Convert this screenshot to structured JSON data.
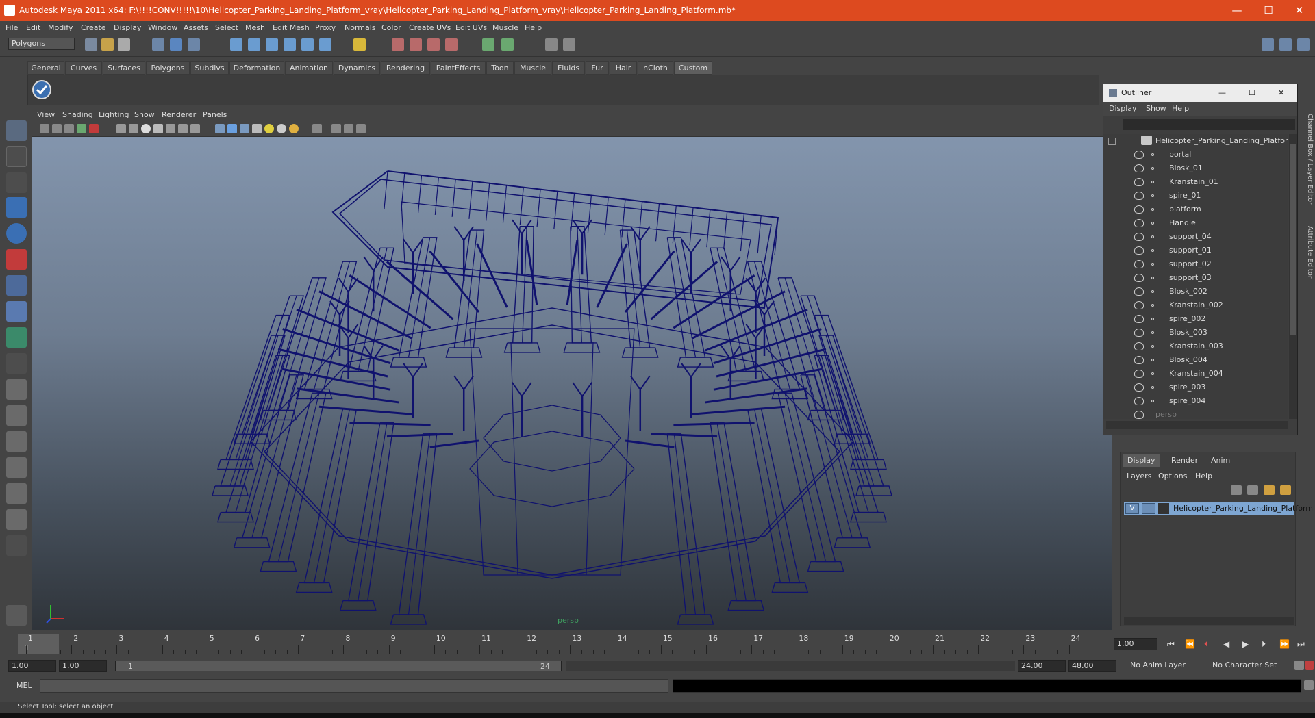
{
  "window": {
    "title": "Autodesk Maya 2011 x64: F:\\!!!!CONV!!!!!\\10\\Helicopter_Parking_Landing_Platform_vray\\Helicopter_Parking_Landing_Platform_vray\\Helicopter_Parking_Landing_Platform.mb*",
    "minimize": "—",
    "maximize": "☐",
    "close": "✕",
    "title_color": "#dd4a1f"
  },
  "menubar": [
    "File",
    "Edit",
    "Modify",
    "Create",
    "Display",
    "Window",
    "Assets",
    "Select",
    "Mesh",
    "Edit Mesh",
    "Proxy",
    "Normals",
    "Color",
    "Create UVs",
    "Edit UVs",
    "Muscle",
    "Help"
  ],
  "status": {
    "mode": "Polygons"
  },
  "shelf_tabs": [
    {
      "label": "General"
    },
    {
      "label": "Curves"
    },
    {
      "label": "Surfaces"
    },
    {
      "label": "Polygons"
    },
    {
      "label": "Subdivs"
    },
    {
      "label": "Deformation"
    },
    {
      "label": "Animation"
    },
    {
      "label": "Dynamics"
    },
    {
      "label": "Rendering"
    },
    {
      "label": "PaintEffects"
    },
    {
      "label": "Toon"
    },
    {
      "label": "Muscle"
    },
    {
      "label": "Fluids"
    },
    {
      "label": "Fur"
    },
    {
      "label": "Hair"
    },
    {
      "label": "nCloth"
    },
    {
      "label": "Custom",
      "active": true
    }
  ],
  "viewport": {
    "menu": [
      "View",
      "Shading",
      "Lighting",
      "Show",
      "Renderer",
      "Panels"
    ],
    "camera": "persp",
    "wire_color": "#10126e"
  },
  "outliner": {
    "title": "Outliner",
    "menu": [
      "Display",
      "Show",
      "Help"
    ],
    "root": "Helicopter_Parking_Landing_Platform",
    "items": [
      "portal",
      "Blosk_01",
      "Kranstain_01",
      "spire_01",
      "platform",
      "Handle",
      "support_04",
      "support_01",
      "support_02",
      "support_03",
      "Blosk_002",
      "Kranstain_002",
      "spire_002",
      "Blosk_003",
      "Kranstain_003",
      "Blosk_004",
      "Kranstain_004",
      "spire_003",
      "spire_004"
    ],
    "trailing": "persp"
  },
  "side_tabs": [
    "Channel Box / Layer Editor",
    "Attribute Editor"
  ],
  "layers": {
    "tabs": [
      "Display",
      "Render",
      "Anim"
    ],
    "menu": [
      "Layers",
      "Options",
      "Help"
    ],
    "layer_name": "Helicopter_Parking_Landing_Platform",
    "visible_flag": "V"
  },
  "timeline": {
    "frames": [
      "1",
      "2",
      "3",
      "4",
      "5",
      "6",
      "7",
      "8",
      "9",
      "10",
      "11",
      "12",
      "13",
      "14",
      "15",
      "16",
      "17",
      "18",
      "19",
      "20",
      "21",
      "22",
      "23",
      "24"
    ],
    "current": "1",
    "current_field": "1.00"
  },
  "range": {
    "start": "1.00",
    "start_inner": "1.00",
    "bar_start": "1",
    "bar_end": "24",
    "end_inner": "24.00",
    "end": "48.00",
    "anim_layer": "No Anim Layer",
    "char_set": "No Character Set"
  },
  "cmd": {
    "label": "MEL"
  },
  "help": {
    "text": "Select Tool: select an object"
  }
}
